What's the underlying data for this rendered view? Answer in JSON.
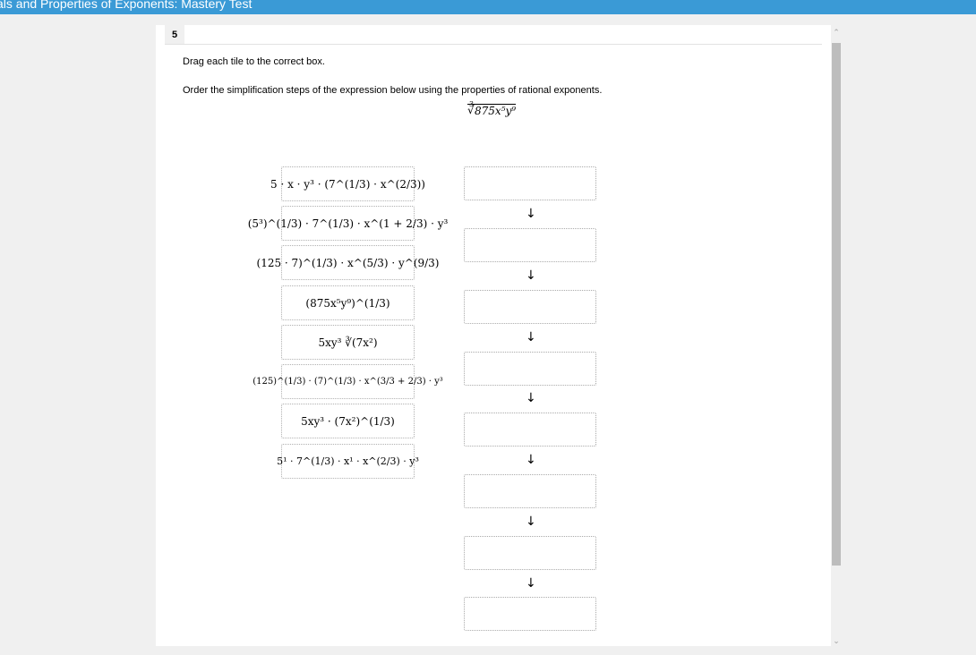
{
  "header": {
    "title": "als and Properties of Exponents: Mastery Test"
  },
  "question": {
    "number": "5",
    "instruction": "Drag each tile to the correct box.",
    "prompt": "Order the simplification steps of the expression below using the properties of rational exponents.",
    "expression": {
      "index": "3",
      "radicand": "875x⁵y⁹"
    }
  },
  "tiles": [
    {
      "text": "5 · x · y³ · (7^(1/3) · x^(2/3))"
    },
    {
      "text": "(5³)^(1/3) · 7^(1/3) · x^(1 + 2/3) · y³"
    },
    {
      "text": "(125 · 7)^(1/3) · x^(5/3) · y^(9/3)"
    },
    {
      "text": "(875x⁵y⁹)^(1/3)"
    },
    {
      "text": "5xy³ ∛(7x²)"
    },
    {
      "text": "(125)^(1/3) · (7)^(1/3) · x^(3/3 + 2/3) · y³"
    },
    {
      "text": "5xy³ · (7x²)^(1/3)"
    },
    {
      "text": "5¹ · 7^(1/3) · x¹ · x^(2/3) · y³"
    }
  ],
  "drop_boxes": [
    "",
    "",
    "",
    "",
    "",
    "",
    "",
    ""
  ],
  "arrow_glyph": "↓",
  "scrollbar": {
    "up_glyph": "⌃",
    "down_glyph": "⌄"
  }
}
